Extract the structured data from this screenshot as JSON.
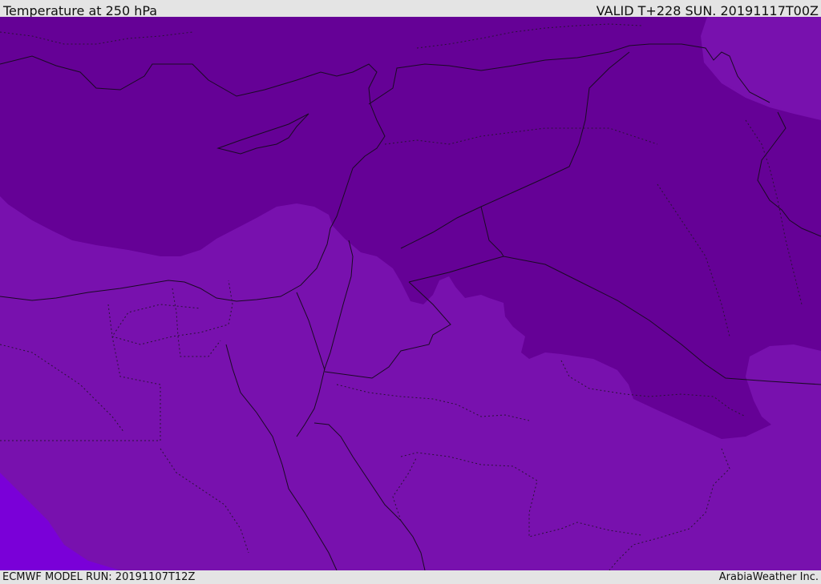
{
  "header": {
    "title": "Temperature at 250 hPa",
    "valid_time": "VALID T+228 SUN. 20191117T00Z"
  },
  "footer": {
    "model_run": "ECMWF MODEL RUN: 20191107T12Z",
    "credit": "ArabiaWeather Inc."
  },
  "map": {
    "field": "temperature",
    "pressure_level": "250 hPa",
    "colors": {
      "band_coldest": "#650196",
      "band_mid": "#7811ae",
      "band_warm": "#7a00d8",
      "coastline": "#1a0a24",
      "border_dotted": "#2a1238"
    }
  }
}
